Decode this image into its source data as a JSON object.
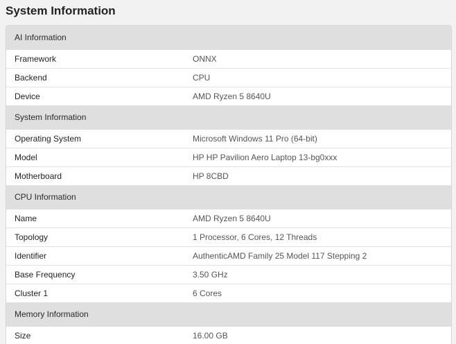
{
  "page": {
    "title": "System Information"
  },
  "sections": [
    {
      "header": "AI Information",
      "rows": [
        {
          "key": "Framework",
          "value": "ONNX"
        },
        {
          "key": "Backend",
          "value": "CPU"
        },
        {
          "key": "Device",
          "value": "AMD Ryzen 5 8640U"
        }
      ]
    },
    {
      "header": "System Information",
      "rows": [
        {
          "key": "Operating System",
          "value": "Microsoft Windows 11 Pro (64-bit)"
        },
        {
          "key": "Model",
          "value": "HP HP Pavilion Aero Laptop 13-bg0xxx"
        },
        {
          "key": "Motherboard",
          "value": "HP 8CBD"
        }
      ]
    },
    {
      "header": "CPU Information",
      "rows": [
        {
          "key": "Name",
          "value": "AMD Ryzen 5 8640U"
        },
        {
          "key": "Topology",
          "value": "1 Processor, 6 Cores, 12 Threads"
        },
        {
          "key": "Identifier",
          "value": "AuthenticAMD Family 25 Model 117 Stepping 2"
        },
        {
          "key": "Base Frequency",
          "value": "3.50 GHz"
        },
        {
          "key": "Cluster 1",
          "value": "6 Cores"
        }
      ]
    },
    {
      "header": "Memory Information",
      "rows": [
        {
          "key": "Size",
          "value": "16.00 GB"
        }
      ]
    }
  ]
}
